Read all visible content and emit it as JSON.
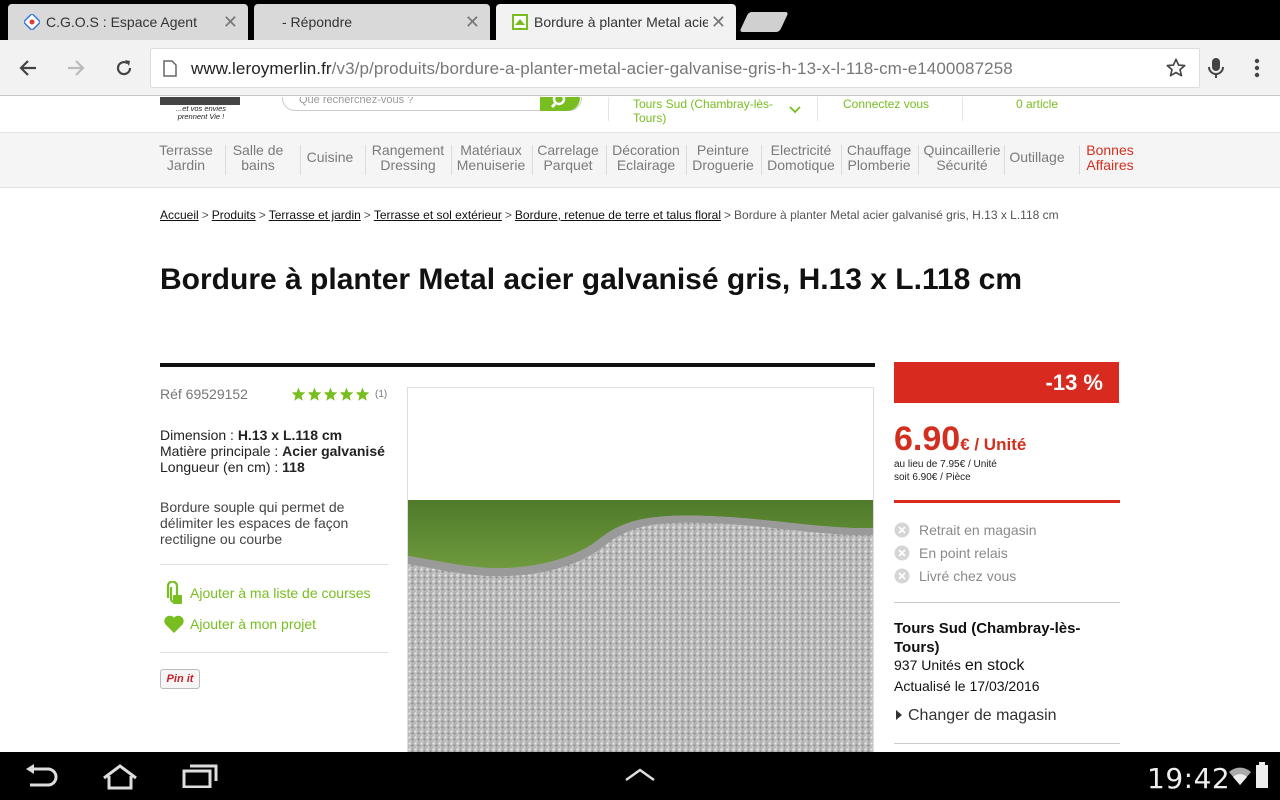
{
  "browser": {
    "tabs": [
      {
        "title": "C.G.O.S : Espace Agent",
        "active": false
      },
      {
        "title": "- Répondre",
        "active": false
      },
      {
        "title": "Bordure à planter Metal acier",
        "active": true
      }
    ],
    "url_host": "www.leroymerlin.fr",
    "url_path": "/v3/p/produits/bordure-a-planter-metal-acier-galvanise-gris-h-13-x-l-118-cm-e1400087258",
    "icons": [
      "back-icon",
      "forward-icon",
      "reload-icon",
      "page-icon",
      "star-icon",
      "mic-icon",
      "menu-icon"
    ]
  },
  "site_header": {
    "logo_tagline": "...et vos envies prennent Vie !",
    "search_placeholder": "Que recherchez-vous ?",
    "store": "Tours Sud (Chambray-lès-Tours)",
    "account": "Connectez vous",
    "cart": "0 article"
  },
  "nav": [
    {
      "line1": "Terrasse",
      "line2": "Jardin"
    },
    {
      "line1": "Salle de",
      "line2": "bains"
    },
    {
      "line1": "Cuisine",
      "line2": ""
    },
    {
      "line1": "Rangement",
      "line2": "Dressing"
    },
    {
      "line1": "Matériaux",
      "line2": "Menuiserie"
    },
    {
      "line1": "Carrelage",
      "line2": "Parquet"
    },
    {
      "line1": "Décoration",
      "line2": "Eclairage"
    },
    {
      "line1": "Peinture",
      "line2": "Droguerie"
    },
    {
      "line1": "Electricité",
      "line2": "Domotique"
    },
    {
      "line1": "Chauffage",
      "line2": "Plomberie"
    },
    {
      "line1": "Quincaillerie",
      "line2": "Sécurité"
    },
    {
      "line1": "Outillage",
      "line2": ""
    },
    {
      "line1": "Bonnes",
      "line2": "Affaires"
    }
  ],
  "breadcrumb": {
    "links": [
      "Accueil",
      "Produits",
      "Terrasse et jardin",
      "Terrasse et sol extérieur",
      "Bordure, retenue de terre et talus floral"
    ],
    "current": "Bordure à planter Metal acier galvanisé gris, H.13 x L.118 cm"
  },
  "product": {
    "title": "Bordure à planter Metal acier galvanisé gris, H.13 x L.118 cm",
    "ref": "Réf 69529152",
    "rating": 5,
    "rating_max": 5,
    "review_count": "(1)",
    "specs": [
      {
        "label": "Dimension : ",
        "value": "H.13 x L.118 cm"
      },
      {
        "label": "Matière principale : ",
        "value": "Acier galvanisé"
      },
      {
        "label": "Longueur (en cm) : ",
        "value": "118"
      }
    ],
    "description": "Bordure souple qui permet de délimiter les espaces de façon rectiligne ou courbe",
    "action_list": "Ajouter à ma liste de courses",
    "action_project": "Ajouter à mon projet",
    "pinit": "Pin it"
  },
  "pricing": {
    "discount": "-13 %",
    "price": "6.90",
    "price_unit": "€ / Unité",
    "was": "au lieu de 7.95€ / Unité",
    "per_piece": "soit 6.90€ / Pièce",
    "availability": [
      "Retrait en magasin",
      "En point relais",
      "Livré chez vous"
    ],
    "store": "Tours Sud (Chambray-lès-Tours)",
    "stock_qty": "937 Unités",
    "stock_status": "en stock",
    "updated": "Actualisé le 17/03/2016",
    "change_store": "Changer de magasin"
  },
  "system_bar": {
    "time": "19:42",
    "icons": [
      "back-icon",
      "home-icon",
      "recents-icon",
      "up-arrow-icon",
      "wifi-icon",
      "battery-icon"
    ]
  },
  "colors": {
    "brand_green": "#78be20",
    "promo_red": "#d82a1f",
    "price_red": "#d32f1f"
  }
}
